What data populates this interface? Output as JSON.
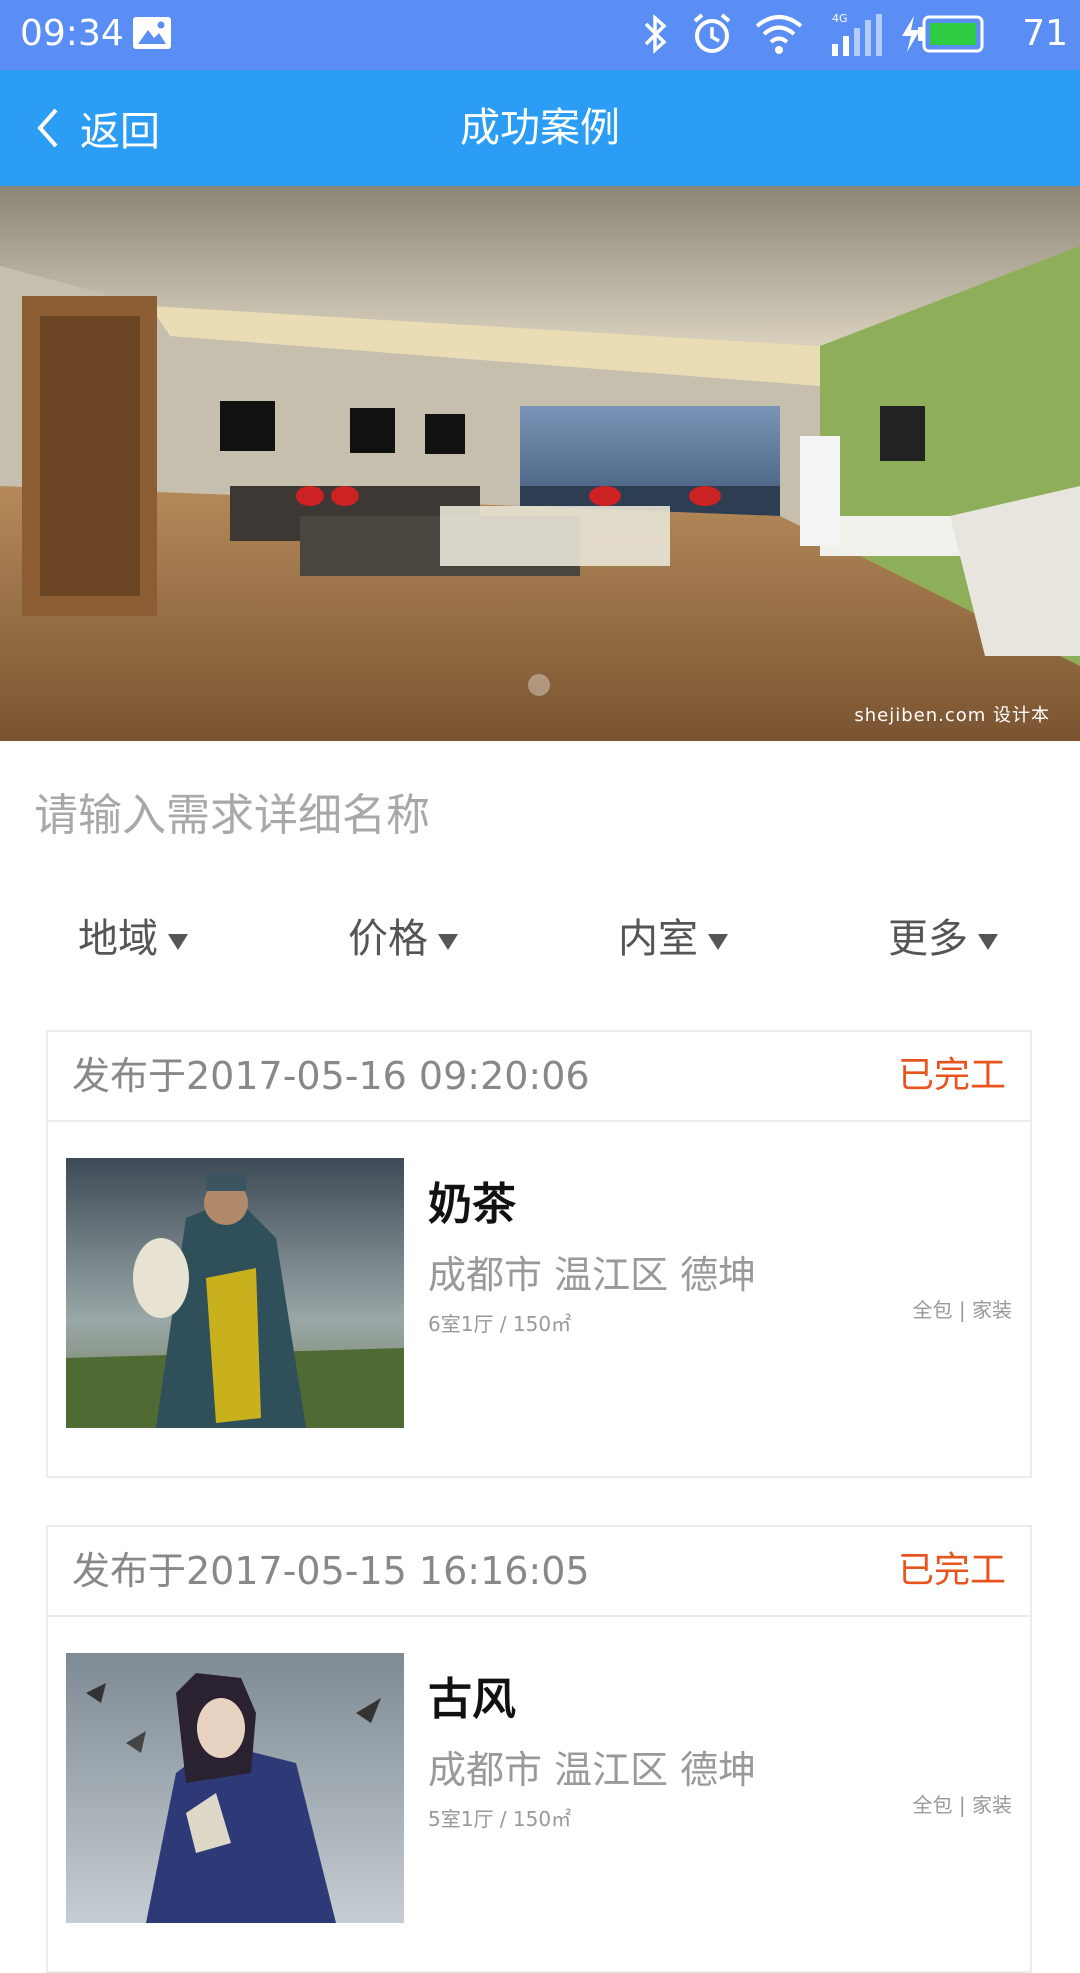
{
  "status_bar": {
    "time": "09:34",
    "battery_level": "71",
    "icons": [
      "image-icon",
      "bluetooth-icon",
      "alarm-icon",
      "wifi-icon",
      "signal-4g-icon",
      "charging-icon",
      "battery-icon"
    ],
    "colors": {
      "background": "#5a8ef5",
      "battery_fill": "#2ecc40"
    }
  },
  "nav": {
    "back_label": "返回",
    "title": "成功案例",
    "color": "#2b9df5"
  },
  "banner": {
    "watermark": "shejiben.com 设计本"
  },
  "search": {
    "placeholder": "请输入需求详细名称"
  },
  "filters": [
    {
      "label": "地域"
    },
    {
      "label": "价格"
    },
    {
      "label": "内室"
    },
    {
      "label": "更多"
    }
  ],
  "cases": [
    {
      "date": "发布于2017-05-16 09:20:06",
      "status": "已完工",
      "name": "奶茶",
      "location": "成都市 温江区 德坤",
      "rooms": "6室1厅 / 150㎡",
      "tags": "全包 | 家装"
    },
    {
      "date": "发布于2017-05-15 16:16:05",
      "status": "已完工",
      "name": "古风",
      "location": "成都市 温江区 德坤",
      "rooms": "5室1厅 / 150㎡",
      "tags": "全包 | 家装"
    }
  ],
  "accent_colors": {
    "status": "#e8541e"
  }
}
